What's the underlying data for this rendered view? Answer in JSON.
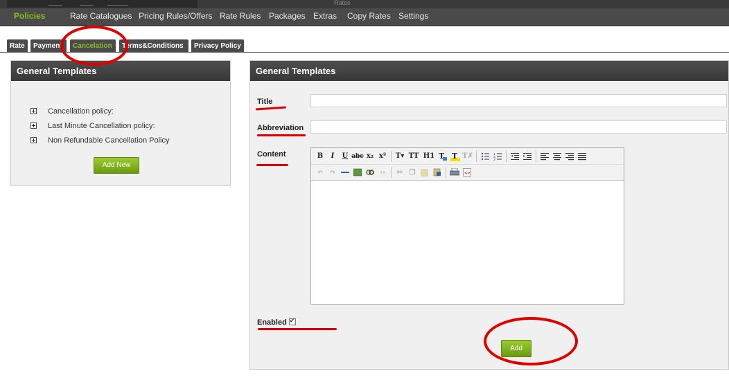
{
  "top": {
    "title": "Rates"
  },
  "nav": {
    "items": [
      {
        "label": "Policies",
        "active": true
      },
      {
        "label": "Rate Catalogues"
      },
      {
        "label": "Pricing Rules/Offers"
      },
      {
        "label": "Rate Rules"
      },
      {
        "label": "Packages"
      },
      {
        "label": "Extras"
      },
      {
        "label": "Copy Rates"
      },
      {
        "label": "Settings"
      }
    ]
  },
  "tabs": [
    {
      "label": "Rate"
    },
    {
      "label": "Payment"
    },
    {
      "label": "Cancelation",
      "active": true
    },
    {
      "label": "Terms&Conditions"
    },
    {
      "label": "Privacy Policy"
    }
  ],
  "left_panel": {
    "title": "General Templates",
    "items": [
      {
        "label": "Cancellation policy:"
      },
      {
        "label": "Last Minute Cancellation policy:"
      },
      {
        "label": "Non Refundable Cancellation Policy"
      }
    ],
    "add_new_label": "Add New"
  },
  "right_panel": {
    "title": "General Templates",
    "title_label": "Title",
    "title_value": "",
    "abbreviation_label": "Abbreviation",
    "abbreviation_value": "",
    "content_label": "Content",
    "content_value": "",
    "enabled_label": "Enabled",
    "enabled_checked": true,
    "add_label": "Add"
  },
  "toolbar": {
    "row1": [
      "bold-icon",
      "italic-icon",
      "underline-icon",
      "strikethrough-icon",
      "subscript-icon",
      "superscript-icon",
      "font-family-icon",
      "font-size-icon",
      "heading-icon",
      "text-color-icon",
      "highlight-icon",
      "clear-format-icon",
      "bullet-list-icon",
      "numbered-list-icon",
      "outdent-icon",
      "indent-icon",
      "align-left-icon",
      "align-center-icon",
      "align-right-icon",
      "align-justify-icon"
    ],
    "row2": [
      "undo-icon",
      "redo-icon",
      "horizontal-rule-icon",
      "image-icon",
      "link-icon",
      "unlink-icon",
      "cut-icon",
      "copy-icon",
      "paste-icon",
      "paste-word-icon",
      "print-icon",
      "source-code-icon"
    ]
  },
  "colors": {
    "accent": "#8bbf1f",
    "annotation": "#e00000",
    "header_bg": "#444444"
  }
}
